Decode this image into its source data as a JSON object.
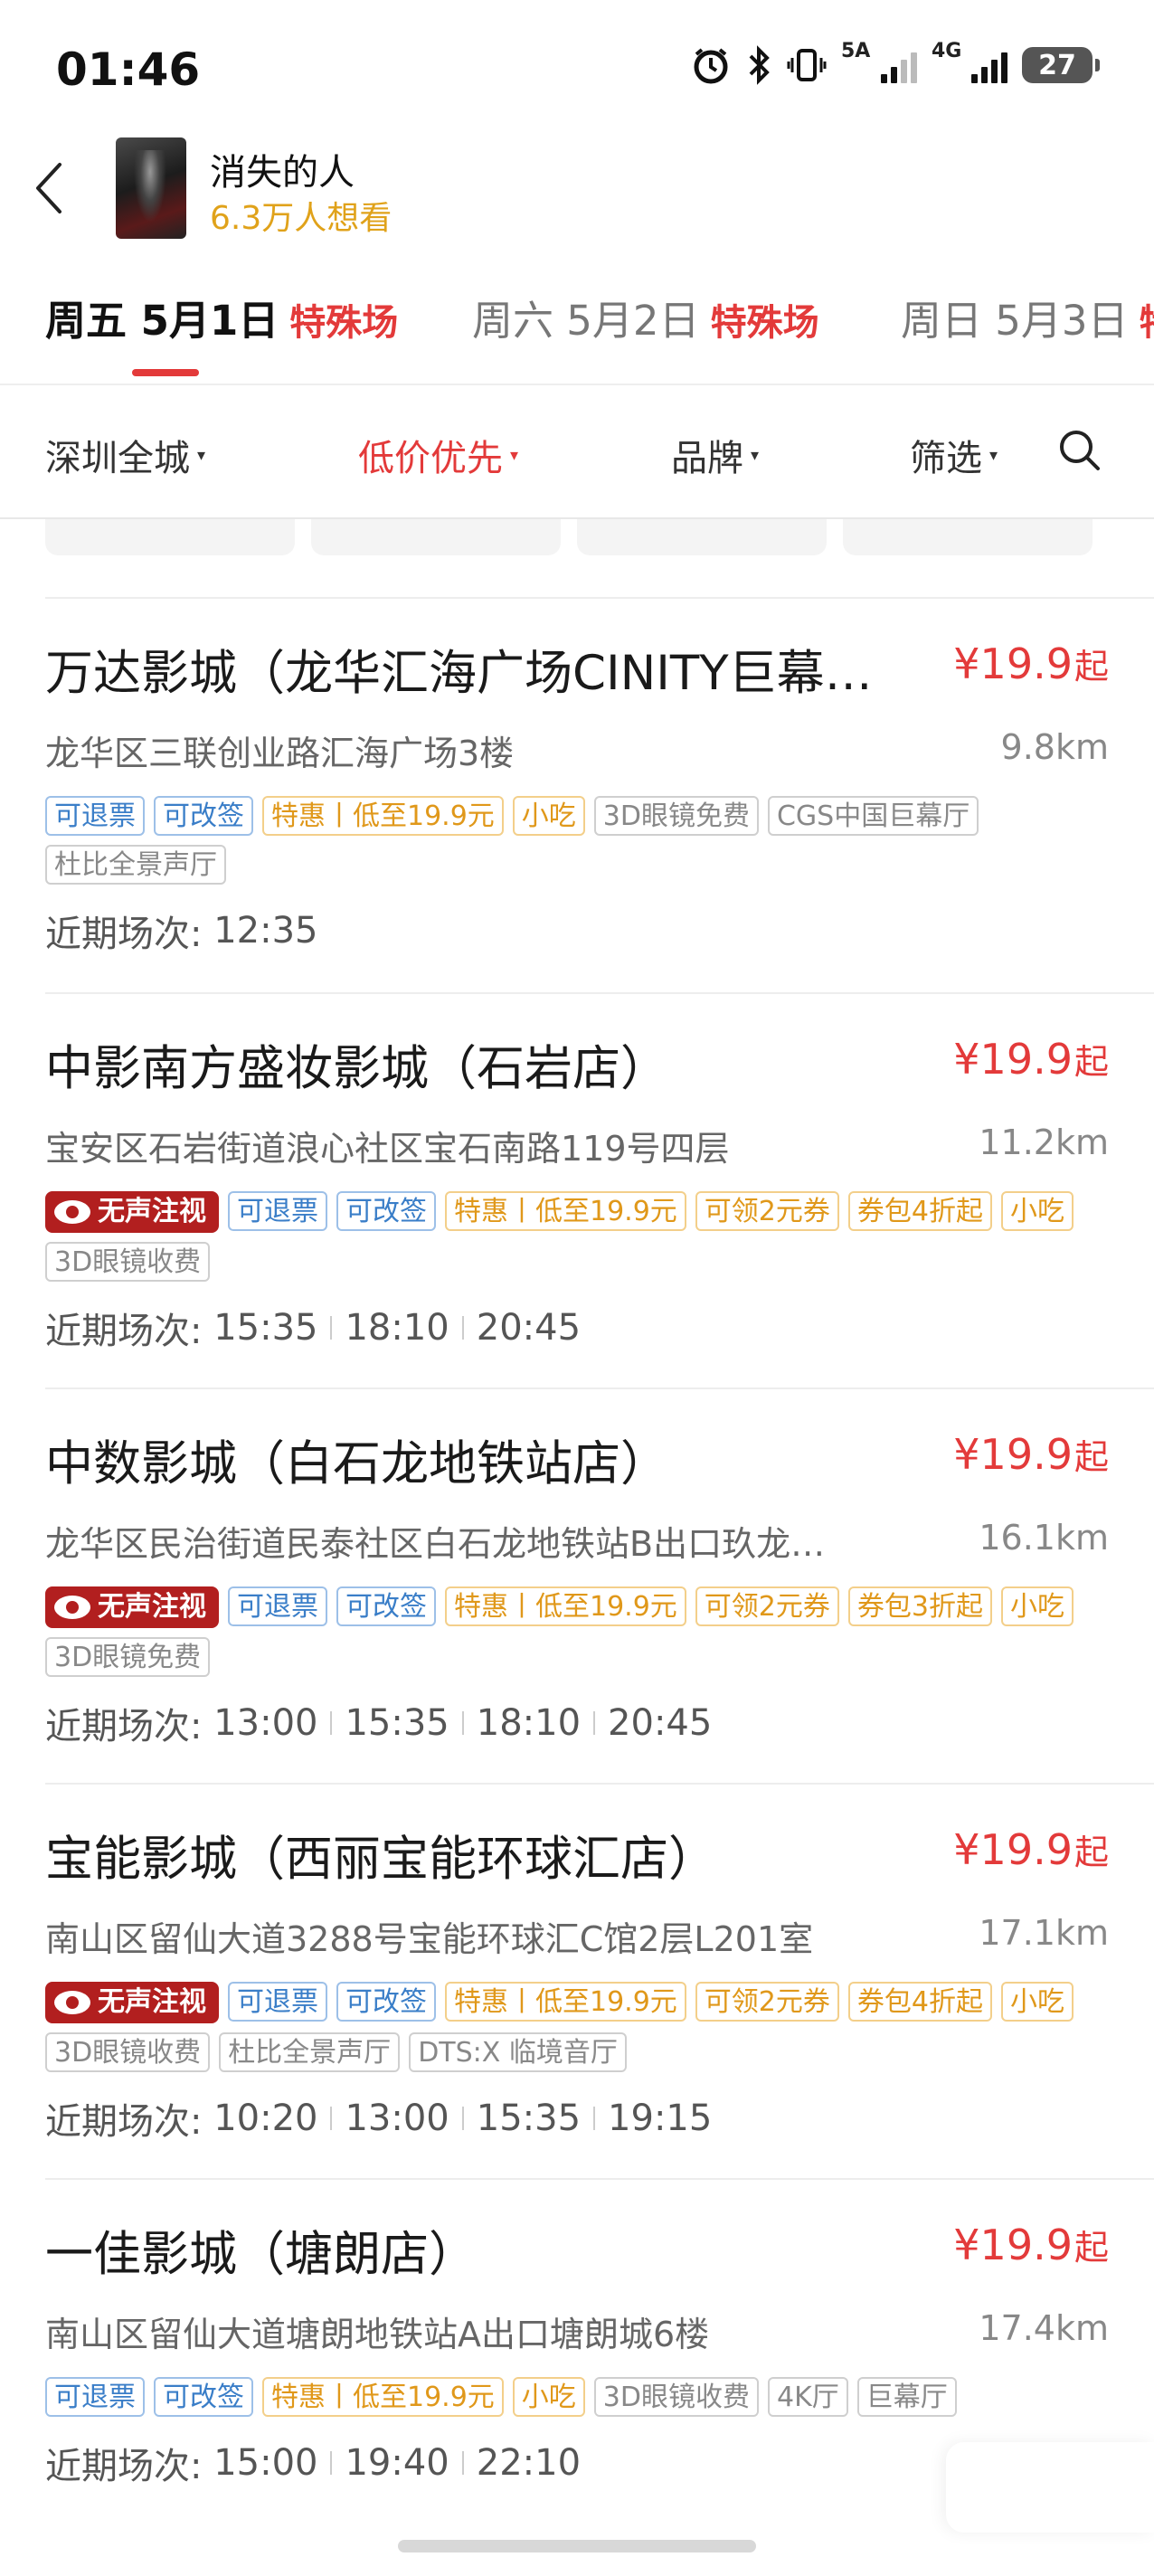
{
  "status_bar": {
    "time": "01:46",
    "signal1_label": "5A",
    "signal2_label": "4G",
    "battery": "27"
  },
  "movie": {
    "title": "消失的人",
    "want_count": "6.3万人想看"
  },
  "date_tabs": [
    {
      "date": "周五 5月1日",
      "special": "特殊场",
      "active": true
    },
    {
      "date": "周六 5月2日",
      "special": "特殊场",
      "active": false
    },
    {
      "date": "周日 5月3日",
      "special": "特",
      "active": false
    }
  ],
  "filters": {
    "city": "深圳全城",
    "sort": "低价优先",
    "brand": "品牌",
    "filter": "筛选"
  },
  "cinemas": [
    {
      "name": "万达影城（龙华汇海广场CINITY巨幕…",
      "price": "¥19.9",
      "price_suffix": "起",
      "address": "龙华区三联创业路汇海广场3楼",
      "distance": "9.8km",
      "silent": false,
      "tags": [
        {
          "text": "可退票",
          "style": "blue"
        },
        {
          "text": "可改签",
          "style": "blue"
        },
        {
          "text": "特惠丨低至19.9元",
          "style": "orange"
        },
        {
          "text": "小吃",
          "style": "orange"
        },
        {
          "text": "3D眼镜免费",
          "style": "gray"
        },
        {
          "text": "CGS中国巨幕厅",
          "style": "gray"
        },
        {
          "text": "杜比全景声厅",
          "style": "gray"
        }
      ],
      "shows_label": "近期场次: ",
      "shows": [
        "12:35"
      ]
    },
    {
      "name": "中影南方盛妆影城（石岩店）",
      "price": "¥19.9",
      "price_suffix": "起",
      "address": "宝安区石岩街道浪心社区宝石南路119号四层",
      "distance": "11.2km",
      "silent": true,
      "silent_label": "无声注视",
      "tags": [
        {
          "text": "可退票",
          "style": "blue"
        },
        {
          "text": "可改签",
          "style": "blue"
        },
        {
          "text": "特惠丨低至19.9元",
          "style": "orange"
        },
        {
          "text": "可领2元券",
          "style": "orange"
        },
        {
          "text": "券包4折起",
          "style": "orange"
        },
        {
          "text": "小吃",
          "style": "orange"
        },
        {
          "text": "3D眼镜收费",
          "style": "gray"
        }
      ],
      "shows_label": "近期场次: ",
      "shows": [
        "15:35",
        "18:10",
        "20:45"
      ]
    },
    {
      "name": "中数影城（白石龙地铁站店）",
      "price": "¥19.9",
      "price_suffix": "起",
      "address": "龙华区民治街道民泰社区白石龙地铁站B出口玖龙…",
      "distance": "16.1km",
      "silent": true,
      "silent_label": "无声注视",
      "tags": [
        {
          "text": "可退票",
          "style": "blue"
        },
        {
          "text": "可改签",
          "style": "blue"
        },
        {
          "text": "特惠丨低至19.9元",
          "style": "orange"
        },
        {
          "text": "可领2元券",
          "style": "orange"
        },
        {
          "text": "券包3折起",
          "style": "orange"
        },
        {
          "text": "小吃",
          "style": "orange"
        },
        {
          "text": "3D眼镜免费",
          "style": "gray"
        }
      ],
      "shows_label": "近期场次: ",
      "shows": [
        "13:00",
        "15:35",
        "18:10",
        "20:45"
      ]
    },
    {
      "name": "宝能影城（西丽宝能环球汇店）",
      "price": "¥19.9",
      "price_suffix": "起",
      "address": "南山区留仙大道3288号宝能环球汇C馆2层L201室",
      "distance": "17.1km",
      "silent": true,
      "silent_label": "无声注视",
      "tags": [
        {
          "text": "可退票",
          "style": "blue"
        },
        {
          "text": "可改签",
          "style": "blue"
        },
        {
          "text": "特惠丨低至19.9元",
          "style": "orange"
        },
        {
          "text": "可领2元券",
          "style": "orange"
        },
        {
          "text": "券包4折起",
          "style": "orange"
        },
        {
          "text": "小吃",
          "style": "orange"
        },
        {
          "text": "3D眼镜收费",
          "style": "gray"
        },
        {
          "text": "杜比全景声厅",
          "style": "gray"
        },
        {
          "text": "DTS:X 临境音厅",
          "style": "gray"
        }
      ],
      "shows_label": "近期场次: ",
      "shows": [
        "10:20",
        "13:00",
        "15:35",
        "19:15"
      ]
    },
    {
      "name": "一佳影城（塘朗店）",
      "price": "¥19.9",
      "price_suffix": "起",
      "address": "南山区留仙大道塘朗地铁站A出口塘朗城6楼",
      "distance": "17.4km",
      "silent": false,
      "tags": [
        {
          "text": "可退票",
          "style": "blue"
        },
        {
          "text": "可改签",
          "style": "blue"
        },
        {
          "text": "特惠丨低至19.9元",
          "style": "orange"
        },
        {
          "text": "小吃",
          "style": "orange"
        },
        {
          "text": "3D眼镜收费",
          "style": "gray"
        },
        {
          "text": "4K厅",
          "style": "gray"
        },
        {
          "text": "巨幕厅",
          "style": "gray"
        }
      ],
      "shows_label": "近期场次: ",
      "shows": [
        "15:00",
        "19:40",
        "22:10"
      ]
    }
  ],
  "colors": {
    "accent": "#e33a3a",
    "want_yellow": "#e0a21a",
    "tag_blue": "#3a7ec8",
    "tag_orange": "#e0981a",
    "silent_red": "#b21f1f"
  }
}
